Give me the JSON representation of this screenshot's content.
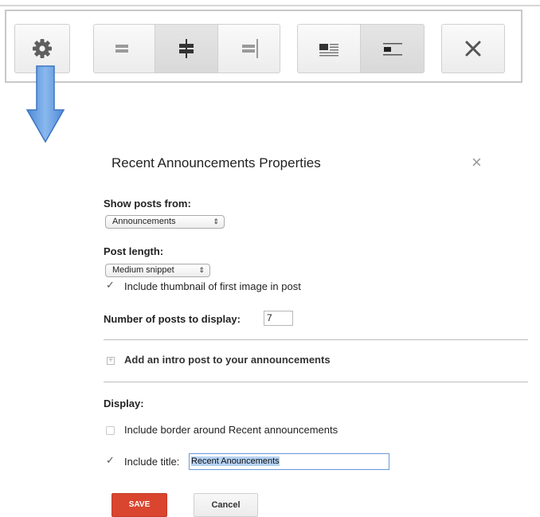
{
  "toolbar": {
    "buttons": [
      {
        "icon": "gear-icon"
      },
      {
        "icon": "align-left-icon"
      },
      {
        "icon": "align-center-icon"
      },
      {
        "icon": "align-right-icon"
      },
      {
        "icon": "wrap-text-icon"
      },
      {
        "icon": "inline-left-icon"
      },
      {
        "icon": "close-icon"
      }
    ],
    "pressed": [
      "align-center-icon",
      "inline-left-icon"
    ]
  },
  "dialog": {
    "title": "Recent Announcements Properties",
    "close_glyph": "×",
    "show_posts_label": "Show posts from:",
    "show_posts_value": "Announcements",
    "post_length_label": "Post length:",
    "post_length_value": "Medium snippet",
    "include_thumbnail_label": "Include thumbnail of first image in post",
    "include_thumbnail_checked": true,
    "num_posts_label": "Number of posts to display:",
    "num_posts_value": "7",
    "intro_post_label": "Add an intro post to your announcements",
    "display_label": "Display:",
    "include_border_label": "Include border around Recent announcements",
    "include_border_checked": false,
    "include_title_label": "Include title:",
    "include_title_checked": true,
    "title_value": "Recent Anouncements",
    "save_label": "SAVE",
    "cancel_label": "Cancel"
  },
  "colors": {
    "save_button": "#d9452f",
    "arrow": "#6fa3e0",
    "selection": "#b5d2f3"
  }
}
